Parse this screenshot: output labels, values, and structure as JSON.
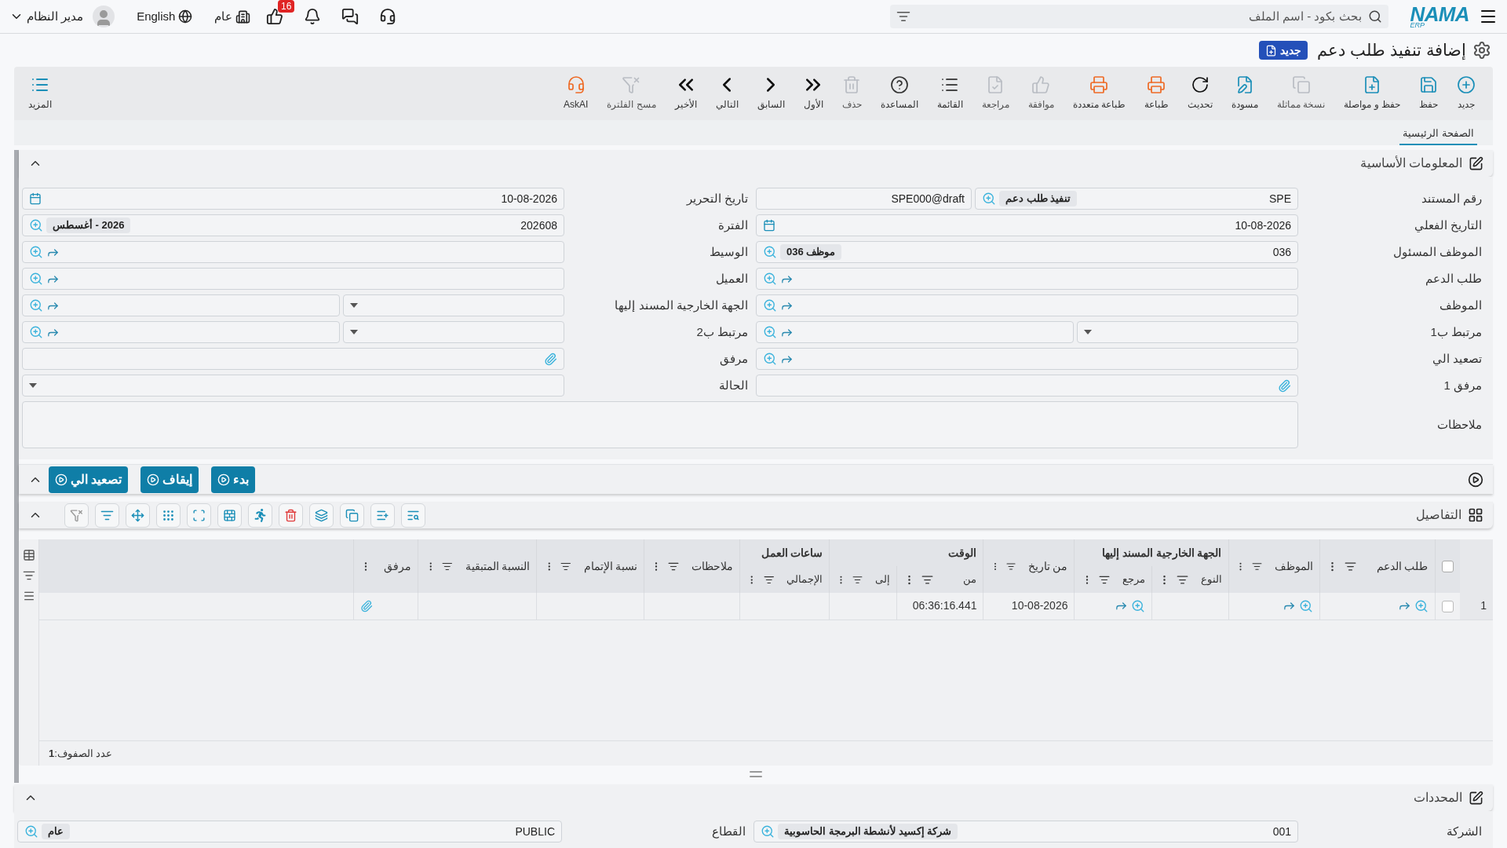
{
  "top_bar": {
    "logo": {
      "name": "NAMA",
      "sub": "ERP"
    },
    "search": {
      "placeholder": "بحث بكود - اسم الملف"
    },
    "notifications": {
      "badge": "16"
    },
    "branch": "عام",
    "language": "English",
    "user": "مدير النظام"
  },
  "page": {
    "title": "إضافة تنفيذ طلب دعم",
    "badge": "جديد"
  },
  "toolbar": {
    "more": "المزيد",
    "items": [
      {
        "label": "جديد",
        "disabled": false
      },
      {
        "label": "حفظ",
        "disabled": false
      },
      {
        "label": "حفظ و مواصلة",
        "disabled": false
      },
      {
        "label": "نسخة مماثلة",
        "disabled": true
      },
      {
        "label": "مسودة",
        "disabled": false
      },
      {
        "label": "تحديث",
        "disabled": false
      },
      {
        "label": "طباعة",
        "disabled": false
      },
      {
        "label": "طباعة متعددة",
        "disabled": false
      },
      {
        "label": "موافقة",
        "disabled": true
      },
      {
        "label": "مراجعة",
        "disabled": true
      },
      {
        "label": "القائمة",
        "disabled": false
      },
      {
        "label": "المساعدة",
        "disabled": false
      },
      {
        "label": "حذف",
        "disabled": true
      },
      {
        "label": "الأول",
        "disabled": false
      },
      {
        "label": "السابق",
        "disabled": false
      },
      {
        "label": "التالي",
        "disabled": false
      },
      {
        "label": "الأخير",
        "disabled": false
      },
      {
        "label": "مسح الفلترة",
        "disabled": true
      },
      {
        "label": "AskAI",
        "disabled": false
      }
    ]
  },
  "tabs": [
    {
      "label": "الصفحة الرئيسية",
      "selected": true
    }
  ],
  "basic_info": {
    "title": "المعلومات الأساسية",
    "expanded": true,
    "fields": [
      {
        "label": "رقم المستند",
        "kind": "doc_no",
        "value": "SPE",
        "tag": "تنفيذ طلب دعم",
        "code": "SPE000@draft"
      },
      {
        "label": "تاريخ التحرير",
        "kind": "date",
        "value": "10-08-2026"
      },
      {
        "label": "التاريخ الفعلي",
        "kind": "date",
        "value": "10-08-2026"
      },
      {
        "label": "الفترة",
        "kind": "code_lookup",
        "value": "202608",
        "tag": "2026 - أغسطس"
      },
      {
        "label": "الموظف المسئول",
        "kind": "code_lookup",
        "value": "036",
        "tag": "موظف 036"
      },
      {
        "label": "الوسيط",
        "kind": "ref"
      },
      {
        "label": "طلب الدعم",
        "kind": "ref"
      },
      {
        "label": "العميل",
        "kind": "ref"
      },
      {
        "label": "الموظف",
        "kind": "ref"
      },
      {
        "label": "الجهة الخارجية المسند إليها",
        "kind": "split"
      },
      {
        "label": "مرتبط ب1",
        "kind": "split"
      },
      {
        "label": "مرتبط ب2",
        "kind": "split"
      },
      {
        "label": "تصعيد الي",
        "kind": "ref"
      },
      {
        "label": "مرفق",
        "kind": "attachment"
      },
      {
        "label": "مرفق 1",
        "kind": "attachment"
      },
      {
        "label": "الحالة",
        "kind": "select"
      },
      {
        "label": "ملاحظات",
        "kind": "textarea"
      }
    ]
  },
  "actions": {
    "expanded": true,
    "buttons": [
      "بدء",
      "إيقاف",
      "تصعيد الي"
    ]
  },
  "details": {
    "title": "التفاصيل",
    "expanded": true,
    "all_checked": false,
    "columns": [
      {
        "label": "طلب الدعم",
        "filter": true
      },
      {
        "label": "الموظف",
        "filter": true
      },
      {
        "label": "النوع",
        "filter": true,
        "group": "الجهة الخارجية المسند إليها"
      },
      {
        "label": "مرجع",
        "filter": true,
        "in_group": true
      },
      {
        "label": "من تاريخ",
        "filter": true
      },
      {
        "label": "من",
        "filter": true,
        "group": "الوقت"
      },
      {
        "label": "إلى",
        "filter": true,
        "in_group": true
      },
      {
        "label": "الإجمالي",
        "filter": true,
        "group": "ساعات العمل"
      },
      {
        "label": "ملاحظات",
        "filter": true
      },
      {
        "label": "نسبة الإتمام",
        "filter": true
      },
      {
        "label": "النسبة المتبقية",
        "filter": true
      },
      {
        "label": "مرفق",
        "filter": false
      }
    ],
    "rows": [
      {
        "number": "1",
        "checked": false,
        "cells": [
          {
            "kind": "lookup"
          },
          {
            "kind": "lookup"
          },
          {
            "kind": "empty"
          },
          {
            "kind": "lookup"
          },
          {
            "kind": "text",
            "value": "10-08-2026"
          },
          {
            "kind": "text",
            "value": "06:36:16.441"
          },
          {
            "kind": "empty"
          },
          {
            "kind": "empty"
          },
          {
            "kind": "empty"
          },
          {
            "kind": "empty"
          },
          {
            "kind": "empty"
          },
          {
            "kind": "attachment"
          }
        ]
      }
    ],
    "footer": "عدد الصفوف:**1**"
  },
  "limits": {
    "title": "المحددات",
    "expanded": true,
    "fields": [
      {
        "label": "الشركة",
        "kind": "code_lookup",
        "value": "001",
        "tag": "شركة إكسيد لأنشطة البرمجة الحاسوبية"
      },
      {
        "label": "القطاع",
        "kind": "code_lookup",
        "value": "PUBLIC",
        "tag": "عام"
      }
    ]
  }
}
